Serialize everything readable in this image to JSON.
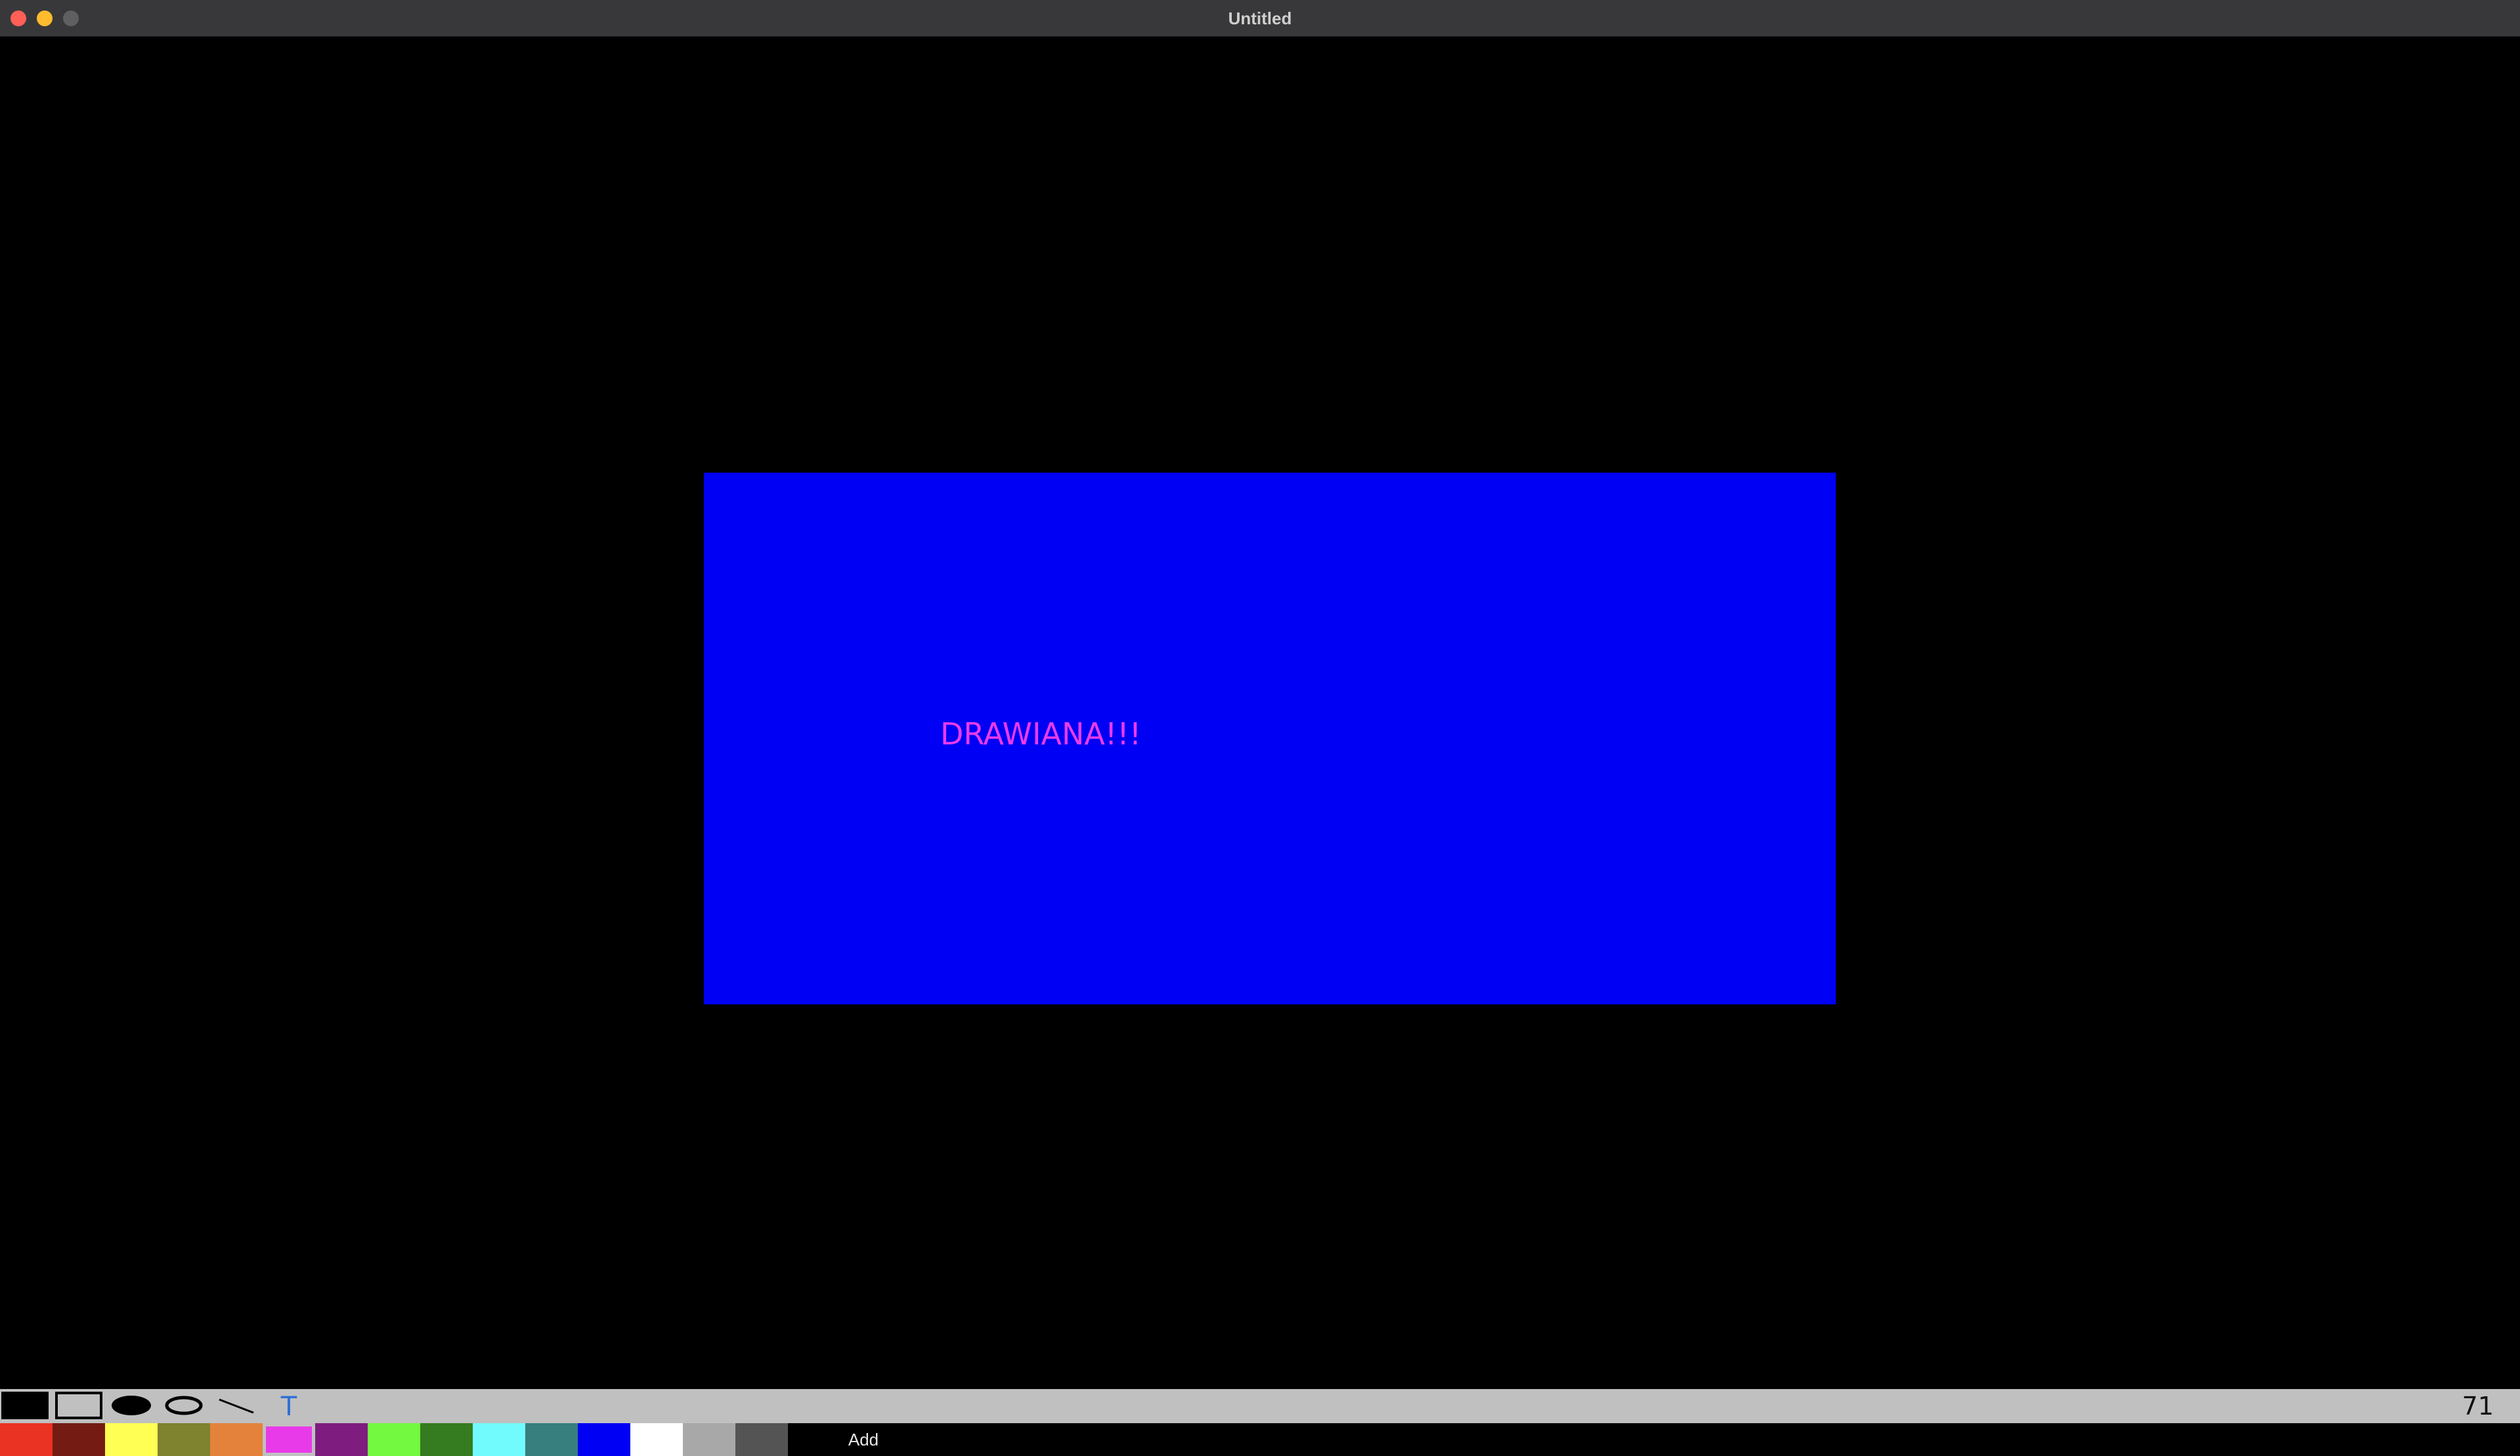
{
  "window": {
    "title": "Untitled"
  },
  "canvas": {
    "background": "#000000",
    "shapes": {
      "rectangle": {
        "kind": "filled-rectangle",
        "color": "#0000f5"
      },
      "text": {
        "kind": "text",
        "value": "DRAWIANA!!!",
        "color": "#e93ae9"
      }
    }
  },
  "toolbar": {
    "tools": [
      {
        "name": "fill-swatch",
        "icon": "filled-square-icon",
        "color": "#000000"
      },
      {
        "name": "rectangle",
        "icon": "rectangle-outline-icon"
      },
      {
        "name": "filled-ellipse",
        "icon": "filled-ellipse-icon"
      },
      {
        "name": "ellipse",
        "icon": "ellipse-outline-icon"
      },
      {
        "name": "line",
        "icon": "line-icon"
      },
      {
        "name": "text",
        "icon": "text-tool-icon",
        "label": "T",
        "color": "#2f6fd6"
      }
    ],
    "counter": "71"
  },
  "palette": {
    "colors": [
      "#ea3323",
      "#741b13",
      "#ffff54",
      "#7f822f",
      "#e4823b",
      "#e93ae9",
      "#7e1d7f",
      "#72f940",
      "#357b20",
      "#72fbfd",
      "#377e7f",
      "#0000f5",
      "#ffffff",
      "#a8a8a8",
      "#545454"
    ],
    "selected_index": 5,
    "add_label": "Add"
  }
}
